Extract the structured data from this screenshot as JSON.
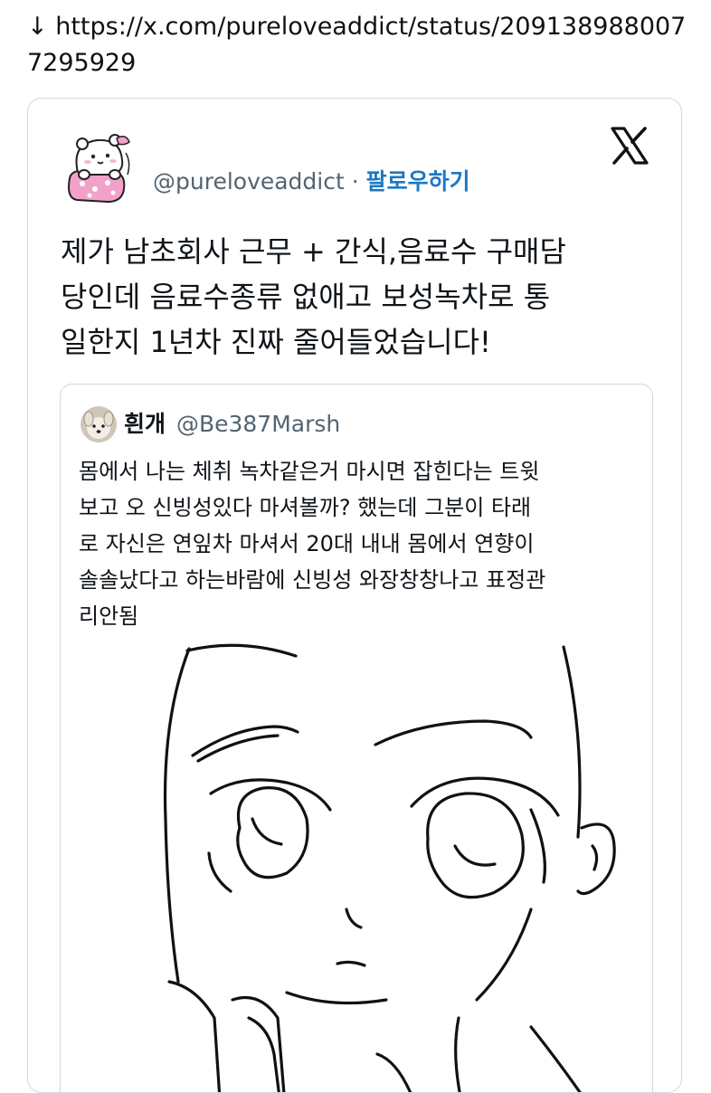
{
  "url_line": {
    "arrow": "↓",
    "url": "https://x.com/pureloveaddict/status/2091389880077295929"
  },
  "tweet": {
    "handle": "@pureloveaddict",
    "separator": "·",
    "follow_label": "팔로우하기",
    "logo_icon": "x-logo-icon",
    "text_lines": [
      "제가 남초회사 근무 + 간식,음료수 구매담",
      "당인데 음료수종류 없애고 보성녹차로 통",
      "일한지 1년차 진짜 줄어들었습니다!"
    ]
  },
  "quote": {
    "name": "흰개",
    "handle": "@Be387Marsh",
    "text_lines": [
      "몸에서 나는 체취 녹차같은거 마시면 잡힌다는 트윗",
      "보고 오 신빙성있다 마셔볼까? 했는데 그분이 타래",
      "로 자신은 연잎차 마셔서 20대 내내 몸에서 연향이",
      "솔솔났다고 하는바람에 신빙성 와장창창나고 표정관",
      "리안됨"
    ],
    "image_icon": "anime-face-sketch"
  },
  "colors": {
    "text": "#0f1419",
    "muted": "#536471",
    "follow": "#1d77c4",
    "border": "#cfd9de"
  }
}
